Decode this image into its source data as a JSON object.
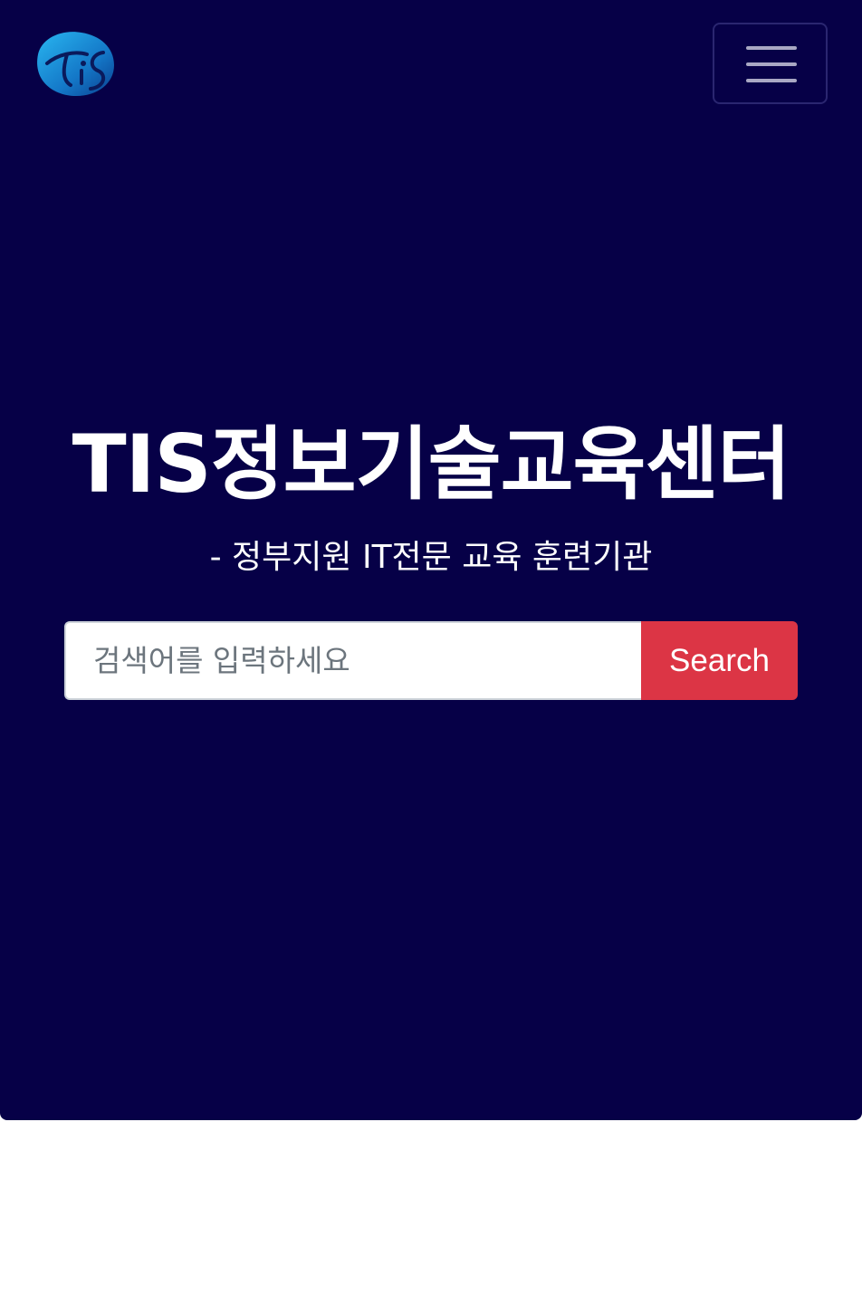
{
  "header": {
    "logo": {
      "icon": "tis-logo-icon",
      "text": "TIS"
    },
    "menu_button": {
      "icon": "hamburger-menu-icon"
    }
  },
  "hero": {
    "title": "TIS정보기술교육센터",
    "subtitle": "- 정부지원 IT전문 교육 훈련기관"
  },
  "search": {
    "placeholder": "검색어를 입력하세요",
    "value": "",
    "button_label": "Search"
  },
  "colors": {
    "hero_background": "#060047",
    "search_button": "#dc3545",
    "logo_blue": "#1593d6"
  }
}
